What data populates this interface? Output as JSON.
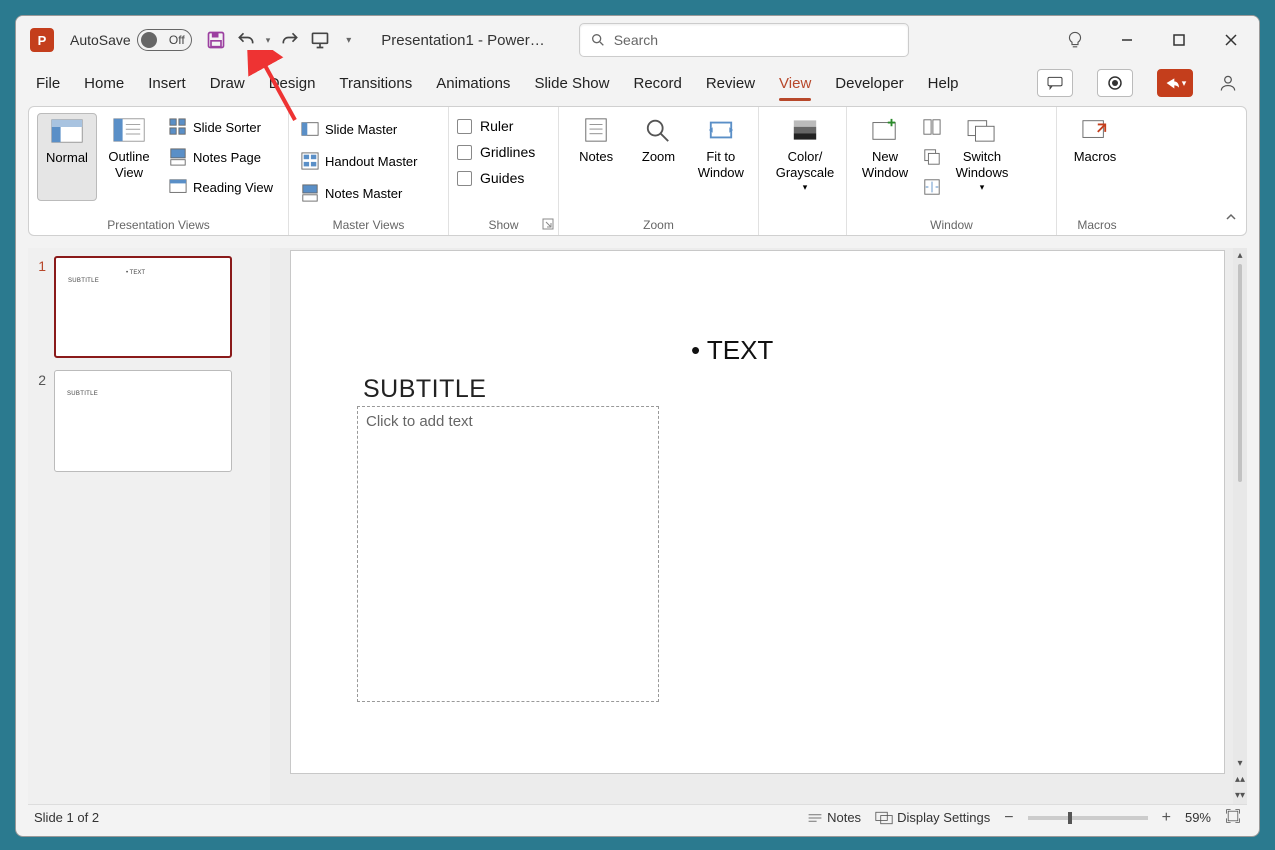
{
  "titlebar": {
    "autosave_label": "AutoSave",
    "autosave_state": "Off",
    "doc_title": "Presentation1  -  Power…",
    "search_placeholder": "Search"
  },
  "tabs": [
    "File",
    "Home",
    "Insert",
    "Draw",
    "Design",
    "Transitions",
    "Animations",
    "Slide Show",
    "Record",
    "Review",
    "View",
    "Developer",
    "Help"
  ],
  "active_tab": "View",
  "ribbon": {
    "presentation_views": {
      "label": "Presentation Views",
      "normal": "Normal",
      "outline": "Outline View",
      "slide_sorter": "Slide Sorter",
      "notes_page": "Notes Page",
      "reading_view": "Reading View"
    },
    "master_views": {
      "label": "Master Views",
      "slide_master": "Slide Master",
      "handout_master": "Handout Master",
      "notes_master": "Notes Master"
    },
    "show": {
      "label": "Show",
      "ruler": "Ruler",
      "gridlines": "Gridlines",
      "guides": "Guides"
    },
    "zoom_group": {
      "label": "Zoom",
      "notes": "Notes",
      "zoom": "Zoom",
      "fit": "Fit to Window"
    },
    "color": {
      "label": "Color/ Grayscale"
    },
    "window": {
      "label": "Window",
      "new_window": "New Window",
      "switch": "Switch Windows"
    },
    "macros": {
      "label": "Macros",
      "btn": "Macros"
    }
  },
  "thumbnails": [
    {
      "num": "1",
      "subtitle": "SUBTITLE",
      "text": "• TEXT",
      "selected": true
    },
    {
      "num": "2",
      "subtitle": "SUBTITLE",
      "text": "",
      "selected": false
    }
  ],
  "slide": {
    "bullet": "• TEXT",
    "subtitle": "SUBTITLE",
    "placeholder": "Click to add text"
  },
  "statusbar": {
    "slide_info": "Slide 1 of 2",
    "notes": "Notes",
    "display_settings": "Display Settings",
    "zoom": "59%"
  }
}
